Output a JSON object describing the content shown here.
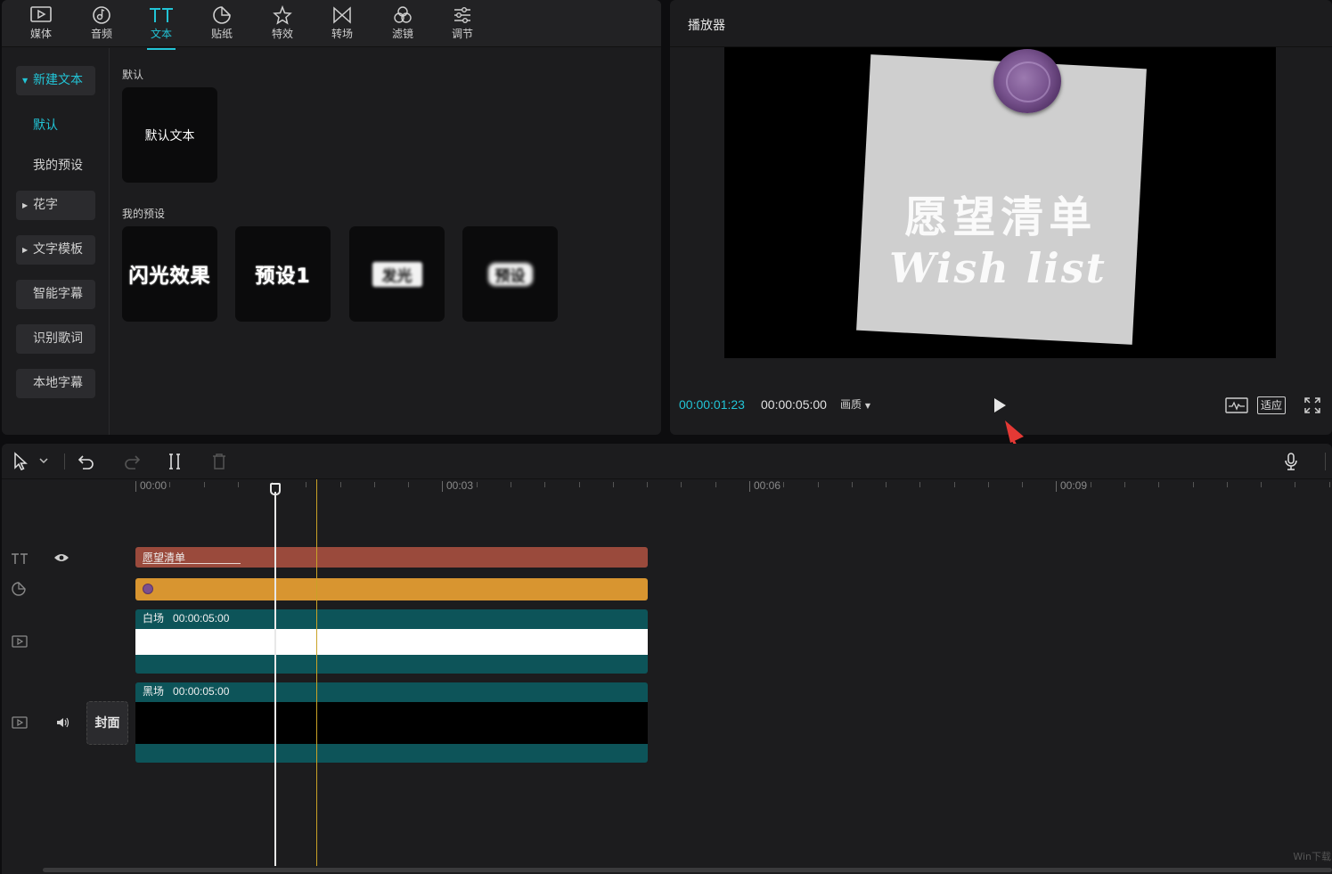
{
  "toolbar": {
    "tabs": [
      {
        "label": "媒体",
        "icon": "media-icon"
      },
      {
        "label": "音频",
        "icon": "audio-icon"
      },
      {
        "label": "文本",
        "icon": "text-icon",
        "active": true
      },
      {
        "label": "贴纸",
        "icon": "sticker-icon"
      },
      {
        "label": "特效",
        "icon": "effects-icon"
      },
      {
        "label": "转场",
        "icon": "transition-icon"
      },
      {
        "label": "滤镜",
        "icon": "filter-icon"
      },
      {
        "label": "调节",
        "icon": "adjust-icon"
      }
    ]
  },
  "sidebar": {
    "items": [
      {
        "label": "新建文本",
        "expandable": true,
        "active": true
      },
      {
        "label": "默认",
        "sub": true,
        "active": true
      },
      {
        "label": "我的预设",
        "sub": true
      },
      {
        "label": "花字",
        "expandable": true
      },
      {
        "label": "文字模板",
        "expandable": true
      },
      {
        "label": "智能字幕"
      },
      {
        "label": "识别歌词"
      },
      {
        "label": "本地字幕"
      }
    ]
  },
  "content": {
    "default_section": "默认",
    "default_card": "默认文本",
    "presets_section": "我的预设",
    "preset_cards": [
      "闪光效果",
      "预设1",
      "发光",
      "预设"
    ]
  },
  "player": {
    "title": "播放器",
    "current_time": "00:00:01:23",
    "total_time": "00:00:05:00",
    "quality_label": "画质",
    "fit_label": "适应",
    "preview_title": "愿望清单",
    "preview_subtitle": "Wish list"
  },
  "timeline": {
    "ruler": [
      "00:00",
      "00:03",
      "00:06",
      "00:09"
    ],
    "text_clip_label": "愿望清单",
    "white_clip": {
      "name": "白场",
      "duration": "00:00:05:00"
    },
    "black_clip": {
      "name": "黑场",
      "duration": "00:00:05:00"
    },
    "cover_label": "封面"
  },
  "watermark": "Win下载",
  "colors": {
    "accent": "#22c4d6",
    "text_clip": "#9a4a3c",
    "sticker_clip": "#d89530",
    "video_clip": "#0d5459",
    "annotation_arrow": "#e53935"
  }
}
